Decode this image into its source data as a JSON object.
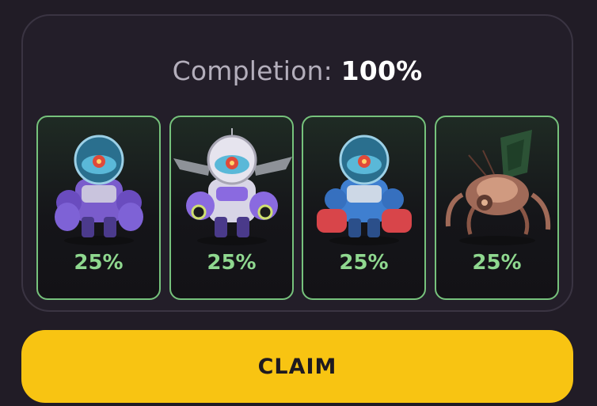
{
  "completion": {
    "label": "Completion:",
    "value": "100%"
  },
  "cards": [
    {
      "name": "robot-purple-icon",
      "percent": "25%",
      "palette": {
        "body": "#7a5ccc",
        "dark": "#4b3a8c",
        "dome": "#5ab8d8",
        "accent": "#e04a3a"
      }
    },
    {
      "name": "robot-winged-icon",
      "percent": "25%",
      "palette": {
        "body": "#8a6ae0",
        "dark": "#4a3a8a",
        "dome": "#5ab8d8",
        "accent": "#cfe070"
      }
    },
    {
      "name": "robot-blue-icon",
      "percent": "25%",
      "palette": {
        "body": "#3f7fd0",
        "dark": "#2b4f8a",
        "dome": "#5ab8d8",
        "accent": "#d8454a"
      }
    },
    {
      "name": "spider-bot-icon",
      "percent": "25%",
      "palette": {
        "body": "#a06a58",
        "dark": "#5e3a30",
        "dome": "#2f5a3a",
        "accent": "#d09a80"
      }
    }
  ],
  "claim_button": {
    "label": "CLAIM"
  }
}
